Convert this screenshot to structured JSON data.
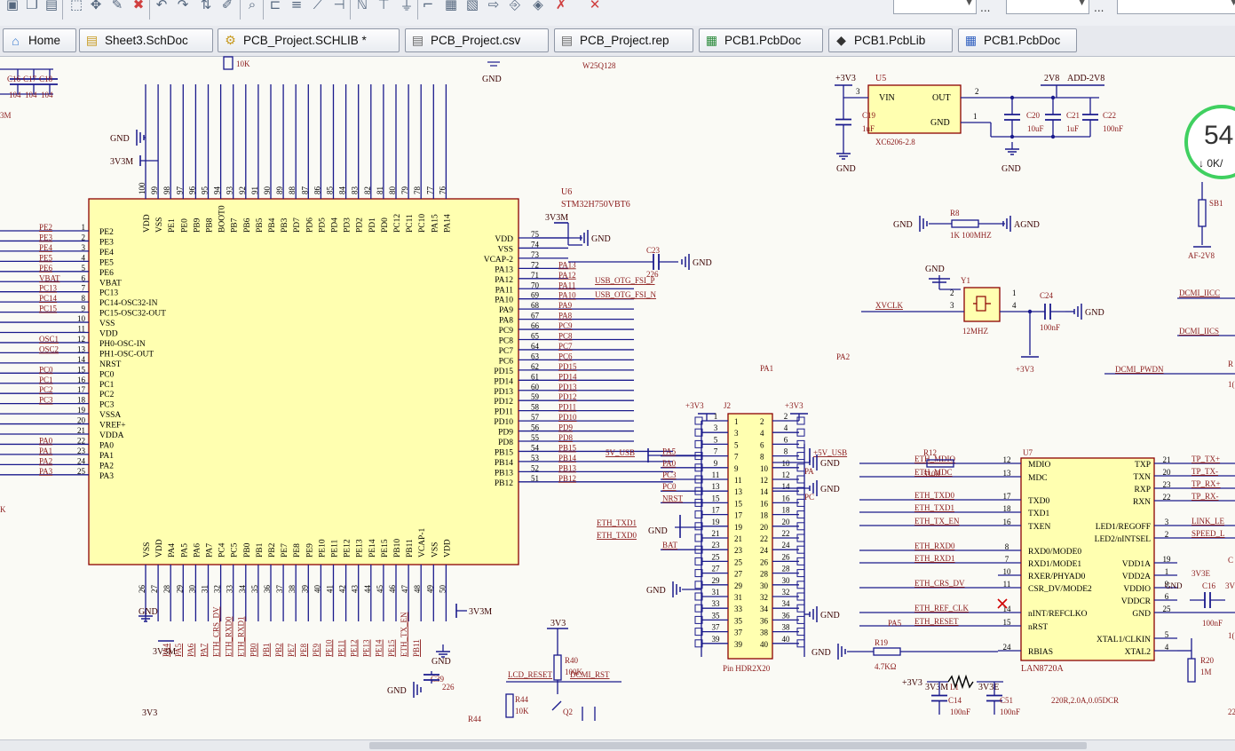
{
  "toolbar": {
    "icons": [
      "paste-icon",
      "copy-icon",
      "clipboard-icon",
      "select-rect-icon",
      "move-icon",
      "wire-edit-icon",
      "delete-icon",
      "undo-icon",
      "redo-icon",
      "align-icon",
      "brush-icon",
      "zoom-icon",
      "net-label-icon",
      "bus-icon",
      "bus-entry-icon",
      "pin-icon",
      "net-icon",
      "power-port-icon",
      "gnd-icon",
      "wire-icon",
      "part-icon",
      "sheet-icon",
      "port-icon",
      "harness-icon",
      "directive-icon",
      "no-erc-icon",
      "close-icon"
    ],
    "combo1_text": "",
    "combo2_text": "",
    "dots": "..."
  },
  "tabs": [
    {
      "label": "Home",
      "icon": "home-icon"
    },
    {
      "label": "Sheet3.SchDoc",
      "icon": "schdoc-icon"
    },
    {
      "label": "PCB_Project.SCHLIB *",
      "icon": "schlib-icon"
    },
    {
      "label": "PCB_Project.csv",
      "icon": "csv-icon"
    },
    {
      "label": "PCB_Project.rep",
      "icon": "report-icon"
    },
    {
      "label": "PCB1.PcbDoc",
      "icon": "pcbdoc-icon"
    },
    {
      "label": "PCB1.PcbLib",
      "icon": "pcblib-icon"
    },
    {
      "label": "PCB1.PcbDoc",
      "icon": "pcbdoc2-icon"
    }
  ],
  "speed_widget": {
    "value": "54",
    "sub": "↓ 0K/"
  },
  "schematic": {
    "mcu": {
      "designator": "U6",
      "part": "STM32H750VBT6",
      "left_pins": [
        {
          "name": "PE2",
          "num": "1",
          "net": "PE2"
        },
        {
          "name": "PE3",
          "num": "2",
          "net": "PE3"
        },
        {
          "name": "PE4",
          "num": "3",
          "net": "PE4"
        },
        {
          "name": "PE5",
          "num": "4",
          "net": "PE5"
        },
        {
          "name": "PE6",
          "num": "5",
          "net": "PE6"
        },
        {
          "name": "VBAT",
          "num": "6",
          "net": "VBAT"
        },
        {
          "name": "PC13",
          "num": "7",
          "net": "PC13"
        },
        {
          "name": "PC14-OSC32-IN",
          "num": "8",
          "net": "PC14"
        },
        {
          "name": "PC15-OSC32-OUT",
          "num": "9",
          "net": "PC15"
        },
        {
          "name": "VSS",
          "num": "10",
          "net": ""
        },
        {
          "name": "VDD",
          "num": "11",
          "net": ""
        },
        {
          "name": "PH0-OSC-IN",
          "num": "12",
          "net": "OSC1"
        },
        {
          "name": "PH1-OSC-OUT",
          "num": "13",
          "net": "OSC2"
        },
        {
          "name": "NRST",
          "num": "14",
          "net": ""
        },
        {
          "name": "PC0",
          "num": "15",
          "net": "PC0"
        },
        {
          "name": "PC1",
          "num": "16",
          "net": "PC1"
        },
        {
          "name": "PC2",
          "num": "17",
          "net": "PC2"
        },
        {
          "name": "PC3",
          "num": "18",
          "net": "PC3"
        },
        {
          "name": "VSSA",
          "num": "19",
          "net": ""
        },
        {
          "name": "VREF+",
          "num": "20",
          "net": ""
        },
        {
          "name": "VDDA",
          "num": "21",
          "net": ""
        },
        {
          "name": "PA0",
          "num": "22",
          "net": "PA0"
        },
        {
          "name": "PA1",
          "num": "23",
          "net": "PA1"
        },
        {
          "name": "PA2",
          "num": "24",
          "net": "PA2"
        },
        {
          "name": "PA3",
          "num": "25",
          "net": "PA3"
        }
      ],
      "right_pins": [
        {
          "name": "VDD",
          "num": "75",
          "net": ""
        },
        {
          "name": "VSS",
          "num": "74",
          "net": ""
        },
        {
          "name": "VCAP-2",
          "num": "73",
          "net": ""
        },
        {
          "name": "PA13",
          "num": "72",
          "net": "PA13"
        },
        {
          "name": "PA12",
          "num": "71",
          "net": "PA12"
        },
        {
          "name": "PA11",
          "num": "70",
          "net": "PA11"
        },
        {
          "name": "PA10",
          "num": "69",
          "net": "PA10"
        },
        {
          "name": "PA9",
          "num": "68",
          "net": "PA9"
        },
        {
          "name": "PA8",
          "num": "67",
          "net": "PA8"
        },
        {
          "name": "PC9",
          "num": "66",
          "net": "PC9"
        },
        {
          "name": "PC8",
          "num": "65",
          "net": "PC8"
        },
        {
          "name": "PC7",
          "num": "64",
          "net": "PC7"
        },
        {
          "name": "PC6",
          "num": "63",
          "net": "PC6"
        },
        {
          "name": "PD15",
          "num": "62",
          "net": "PD15"
        },
        {
          "name": "PD14",
          "num": "61",
          "net": "PD14"
        },
        {
          "name": "PD13",
          "num": "60",
          "net": "PD13"
        },
        {
          "name": "PD12",
          "num": "59",
          "net": "PD12"
        },
        {
          "name": "PD11",
          "num": "58",
          "net": "PD11"
        },
        {
          "name": "PD10",
          "num": "57",
          "net": "PD10"
        },
        {
          "name": "PD9",
          "num": "56",
          "net": "PD9"
        },
        {
          "name": "PD8",
          "num": "55",
          "net": "PD8"
        },
        {
          "name": "PB15",
          "num": "54",
          "net": "PB15"
        },
        {
          "name": "PB14",
          "num": "53",
          "net": "PB14"
        },
        {
          "name": "PB13",
          "num": "52",
          "net": "PB13"
        },
        {
          "name": "PB12",
          "num": "51",
          "net": "PB12"
        }
      ],
      "top_pins": [
        {
          "name": "VDD",
          "num": "100"
        },
        {
          "name": "VSS",
          "num": "99"
        },
        {
          "name": "PE1",
          "num": "98"
        },
        {
          "name": "PE0",
          "num": "97"
        },
        {
          "name": "PB9",
          "num": "96"
        },
        {
          "name": "PB8",
          "num": "95"
        },
        {
          "name": "BOOT0",
          "num": "94"
        },
        {
          "name": "PB7",
          "num": "93"
        },
        {
          "name": "PB6",
          "num": "92"
        },
        {
          "name": "PB5",
          "num": "91"
        },
        {
          "name": "PB4",
          "num": "90"
        },
        {
          "name": "PB3",
          "num": "89"
        },
        {
          "name": "PD7",
          "num": "88"
        },
        {
          "name": "PD6",
          "num": "87"
        },
        {
          "name": "PD5",
          "num": "86"
        },
        {
          "name": "PD4",
          "num": "85"
        },
        {
          "name": "PD3",
          "num": "84"
        },
        {
          "name": "PD2",
          "num": "83"
        },
        {
          "name": "PD1",
          "num": "82"
        },
        {
          "name": "PD0",
          "num": "81"
        },
        {
          "name": "PC12",
          "num": "80"
        },
        {
          "name": "PC11",
          "num": "79"
        },
        {
          "name": "PC10",
          "num": "78"
        },
        {
          "name": "PA15",
          "num": "77"
        },
        {
          "name": "PA14",
          "num": "76"
        }
      ],
      "bottom_pins": [
        {
          "name": "VSS",
          "num": "26"
        },
        {
          "name": "VDD",
          "num": "27"
        },
        {
          "name": "PA4",
          "num": "28"
        },
        {
          "name": "PA5",
          "num": "29"
        },
        {
          "name": "PA6",
          "num": "30"
        },
        {
          "name": "PA7",
          "num": "31"
        },
        {
          "name": "PC4",
          "num": "32"
        },
        {
          "name": "PC5",
          "num": "33"
        },
        {
          "name": "PB0",
          "num": "34"
        },
        {
          "name": "PB1",
          "num": "35"
        },
        {
          "name": "PB2",
          "num": "36"
        },
        {
          "name": "PE7",
          "num": "37"
        },
        {
          "name": "PE8",
          "num": "38"
        },
        {
          "name": "PE9",
          "num": "39"
        },
        {
          "name": "PE10",
          "num": "40"
        },
        {
          "name": "PE11",
          "num": "41"
        },
        {
          "name": "PE12",
          "num": "42"
        },
        {
          "name": "PE13",
          "num": "43"
        },
        {
          "name": "PE14",
          "num": "44"
        },
        {
          "name": "PE15",
          "num": "45"
        },
        {
          "name": "PB10",
          "num": "46"
        },
        {
          "name": "PB11",
          "num": "47"
        },
        {
          "name": "VCAP-1",
          "num": "48"
        },
        {
          "name": "VSS",
          "num": "49"
        },
        {
          "name": "VDD",
          "num": "50"
        }
      ],
      "bottom_nets": [
        "PA4",
        "PA5",
        "PA6",
        "PA7",
        "ETH_CRS_DV",
        "ETH_RXD0",
        "ETH_RXD1",
        "PB0",
        "PB1",
        "PB2",
        "PE7",
        "PE8",
        "PE9",
        "PE10",
        "PE11",
        "PE12",
        "PE13",
        "PE14",
        "PE15",
        "ETH_TX_EN",
        "PB11"
      ]
    },
    "header": {
      "cap_labels": [
        "C16",
        "C17",
        "C18"
      ],
      "cap_values": [
        "104",
        "104",
        "104"
      ],
      "res_10k": "10K",
      "gnd": "GND",
      "flash": "W25Q128",
      "vdd_3v3m": "3V3M",
      "partial_3m": "3M"
    },
    "mcu_side_labels": {
      "gnd_top": "GND",
      "v3v3m_top": "3V3M",
      "v3v3m_right": "3V3M",
      "gnd_right": "GND",
      "c23": "C23",
      "c23_val": "226",
      "gnd_c23": "GND",
      "usb_p": "USB_OTG_FSI_P",
      "usb_n": "USB_OTG_FSI_N",
      "eth_txd1": "ETH_TXD1",
      "eth_txd0": "ETH_TXD0",
      "v5_usb": "5V_USB",
      "k_label": "K",
      "gnd_bl": "GND",
      "gnd_br": "GND",
      "v3v3m_bl": "3V3M",
      "v3v3m_br": "3V3M",
      "v3v3_bot": "3V3",
      "c39": "C39",
      "c39_val": "226",
      "gnd_c39": "GND",
      "pa1": "PA1",
      "pa2": "PA2"
    },
    "regulator": {
      "vin_net": "+3V3",
      "designator": "U5",
      "part": "XC6206-2.8",
      "pin_vin": "VIN",
      "pin_out": "OUT",
      "pin_gnd": "GND",
      "pin_vin_num": "3",
      "pin_out_num": "2",
      "pin_gnd_num": "1",
      "out_net": "2V8",
      "out_net2": "ADD-2V8",
      "c19": "C19",
      "c19_val": "1uF",
      "c20": "C20",
      "c20_val": "10uF",
      "c21": "C21",
      "c21_val": "1uF",
      "c22": "C22",
      "c22_val": "100nF",
      "gnd1": "GND",
      "gnd2": "GND"
    },
    "misc_right": {
      "sb1": "SB1",
      "af_2v8": "AF-2V8",
      "r8": "R8",
      "r8_val": "1K 100MHZ",
      "r8_gnd": "GND",
      "agnd": "AGND",
      "gnd_y1": "GND",
      "y1": "Y1",
      "xvclk": "XVCLK",
      "y1_freq": "12MHZ",
      "c24": "C24",
      "c24_val": "100nF",
      "c24_gnd": "GND",
      "p3v3": "+3V3",
      "dcmi_iicc": "DCMI_IICC",
      "dcmi_iics": "DCMI_IICS",
      "dcmi_pwdn": "DCMI_PWDN",
      "r_part": "R",
      "r_part2": "1(",
      "pin1": "1",
      "pin2": "2",
      "pin3": "3",
      "pin4": "4"
    },
    "connector": {
      "designator": "J2",
      "part": "Pin HDR2X20",
      "left_net_top": "+3V3",
      "right_net_top": "+3V3",
      "left_signals": [
        {
          "pin": "7",
          "net": "PA5"
        },
        {
          "pin": "9",
          "net": "PA0"
        },
        {
          "pin": "11",
          "net": "PC3"
        },
        {
          "pin": "13",
          "net": "PC0"
        },
        {
          "pin": "15",
          "net": "NRST"
        },
        {
          "pin": "23",
          "net": "BAT"
        }
      ],
      "right_5v": "+5V_USB",
      "gnd_labels": [
        "GND",
        "GND",
        "GND",
        "GND",
        "GND"
      ],
      "pa_labels": [
        "PA",
        "PC"
      ],
      "gnd_mid": "GND"
    },
    "phy": {
      "designator": "U7",
      "part": "LAN8720A",
      "left_pins": [
        {
          "name": "MDIO",
          "num": "12",
          "net": "ETH_MDIO"
        },
        {
          "name": "MDC",
          "num": "13",
          "net": "ETH_MDC"
        },
        {
          "name": "TXD0",
          "num": "17",
          "net": "ETH_TXD0"
        },
        {
          "name": "TXD1",
          "num": "18",
          "net": "ETH_TXD1"
        },
        {
          "name": "TXEN",
          "num": "16",
          "net": "ETH_TX_EN"
        },
        {
          "name": "RXD0/MODE0",
          "num": "8",
          "net": "ETH_RXD0"
        },
        {
          "name": "RXD1/MODE1",
          "num": "7",
          "net": "ETH_RXD1"
        },
        {
          "name": "RXER/PHYAD0",
          "num": "10",
          "net": ""
        },
        {
          "name": "CSR_DV/MODE2",
          "num": "11",
          "net": "ETH_CRS_DV"
        },
        {
          "name": "nINT/REFCLKO",
          "num": "14",
          "net": "ETH_REF_CLK"
        },
        {
          "name": "nRST",
          "num": "15",
          "net": "ETH_RESET"
        },
        {
          "name": "RBIAS",
          "num": "24",
          "net": ""
        }
      ],
      "right_pins": [
        {
          "name": "TXP",
          "num": "21",
          "net": "TP_TX+"
        },
        {
          "name": "TXN",
          "num": "20",
          "net": "TP_TX-"
        },
        {
          "name": "RXP",
          "num": "23",
          "net": "TP_RX+"
        },
        {
          "name": "RXN",
          "num": "22",
          "net": "TP_RX-"
        },
        {
          "name": "LED1/REGOFF",
          "num": "3",
          "net": "LINK_LE"
        },
        {
          "name": "LED2/nINTSEL",
          "num": "2",
          "net": "SPEED_L"
        },
        {
          "name": "VDD1A",
          "num": "19",
          "net": ""
        },
        {
          "name": "VDD2A",
          "num": "1",
          "net": ""
        },
        {
          "name": "VDDIO",
          "num": "9",
          "net": ""
        },
        {
          "name": "VDDCR",
          "num": "6",
          "net": ""
        },
        {
          "name": "GND",
          "num": "25",
          "net": ""
        },
        {
          "name": "XTAL1/CLKIN",
          "num": "5",
          "net": ""
        },
        {
          "name": "XTAL2",
          "num": "4",
          "net": ""
        }
      ],
      "r12": "R12",
      "r12_val": "510R",
      "pa5": "PA5",
      "r19": "R19",
      "r19_val": "4.7KΩ",
      "r19_gnd": "GND",
      "r20": "R20",
      "r20_val": "1M",
      "v3e": "3V3E",
      "gnd_c16": "GND",
      "c16": "C16",
      "c16_val": "100nF",
      "frag_1": "1(",
      "frag_c": "C",
      "frag_3v": "3V",
      "frag_22": "22"
    },
    "bottom": {
      "r40": "R40",
      "r40_val": "100K",
      "v3v3_r40": "3V3",
      "lcd_reset": "LCD_RESET",
      "dcmi_rst": "DCMI_RST",
      "r44": "R44",
      "r44_val": "10K",
      "q2": "Q2",
      "r44b": "R44",
      "v3v3": "3V3",
      "v3v3m_l1": "3V3M",
      "l1": "L1",
      "v3v3e": "3V3E",
      "p3v3_l1": "+3V3",
      "c14": "C14",
      "c14_val": "100nF",
      "c51": "C51",
      "c51_val": "100nF",
      "ferrite": "220R,2.0A,0.05DCR"
    }
  }
}
